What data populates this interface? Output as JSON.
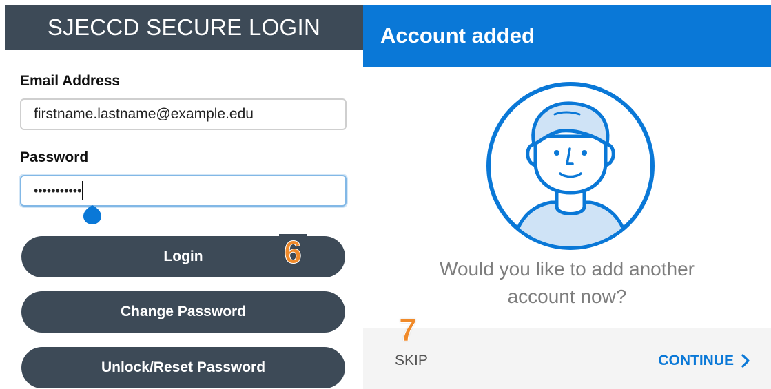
{
  "login_screen": {
    "header_title": "SJECCD SECURE LOGIN",
    "email_label": "Email Address",
    "email_value": "firstname.lastname@example.edu",
    "password_label": "Password",
    "password_mask": "•••••••••••",
    "buttons": {
      "login": "Login",
      "change_password": "Change Password",
      "unlock_reset": "Unlock/Reset Password"
    },
    "step_badge": "6"
  },
  "account_added_screen": {
    "header_title": "Account added",
    "prompt_line1": "Would you like to add another",
    "prompt_line2": "account now?",
    "skip_label": "SKIP",
    "continue_label": "CONTINUE",
    "step_badge": "7"
  },
  "icons": {
    "avatar": "user-avatar-icon",
    "continue_chevron": "chevron-right-icon",
    "caret_handle": "text-cursor-handle-icon"
  },
  "colors": {
    "login_header": "#3d4a57",
    "login_buttons": "#3d4a57",
    "accent_blue": "#0a78d7",
    "step_badge": "#f08a2a",
    "focus_border": "#82b8e6"
  }
}
